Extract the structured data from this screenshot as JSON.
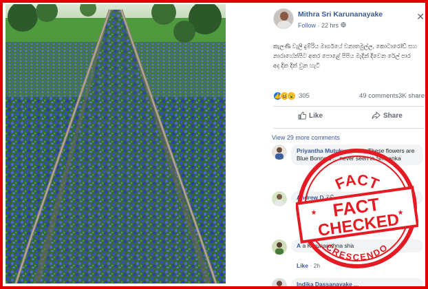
{
  "colors": {
    "frame": "#e00000",
    "link": "#385898",
    "stamp": "#e41b23"
  },
  "post": {
    "author": "Mithra Sri Karunanayake",
    "follow_label": "Follow",
    "separator": "·",
    "time": "22 hrs",
    "globe_icon": "globe-icon",
    "close_icon": "close-icon",
    "caption": "කැලණි වැලි දුම්රිය මාර්ගයේ වනාතමුල්ල, කොටාරෝඩ් සහ නාරාහේන්පිට අතර පොළේ පිපිය මැදින් දිවෙන රේල් පාර අද දින දින් වුන හැටි"
  },
  "reactions": {
    "count": "305",
    "comments": "49 comments",
    "shares": "3K shares"
  },
  "actions": {
    "like_label": "Like",
    "share_label": "Share"
  },
  "comments_section": {
    "view_more": "View 29 more comments",
    "comments": [
      {
        "name": "Priyantha Mutukumarana",
        "text": "These flowers are Blue Bonnets ... never seen in Sri Lanka"
      },
      {
        "name": "Andrew D",
        "text": "ඔව් ..."
      },
      {
        "name": "A",
        "text": "a Karunarathna sha"
      },
      {
        "name": "Indika Dassanayake",
        "text": "..."
      }
    ],
    "like_label": "Like",
    "comment_time": "2h"
  },
  "stamp": {
    "top_text": "FACT",
    "line1": "FACT",
    "line2": "CHECKED",
    "bottom_text": "CRESCENDO"
  }
}
